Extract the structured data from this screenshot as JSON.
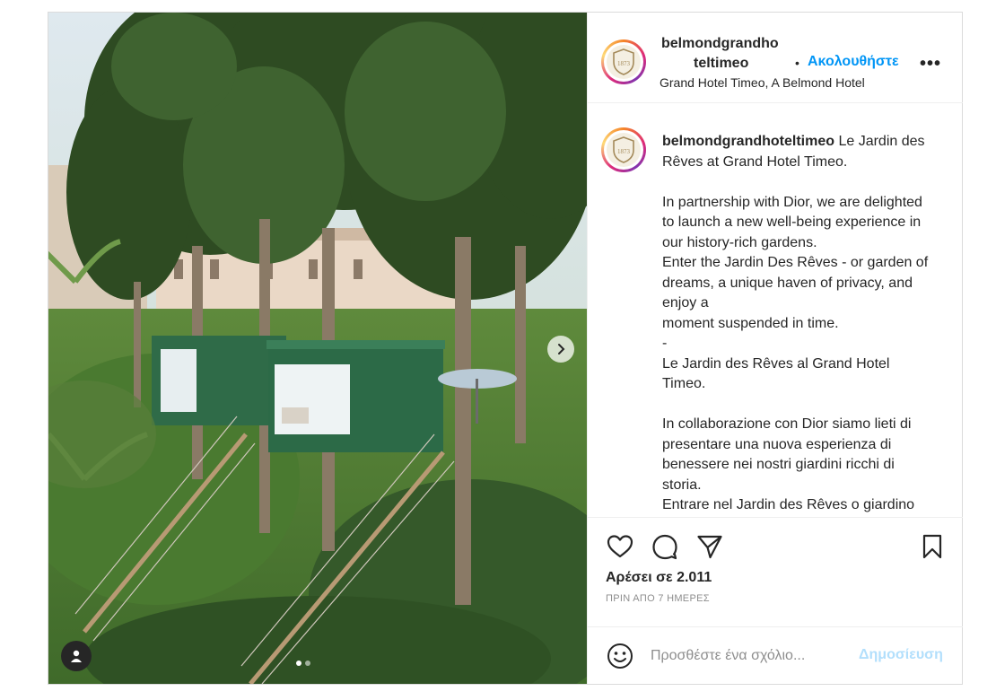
{
  "post": {
    "account": {
      "username_line1": "belmondgrandho",
      "username_line2": "teltimeo",
      "follow_label": "Ακολουθήστε",
      "bullet": "•",
      "more_label": "•••",
      "location": "Grand Hotel Timeo, A Belmond Hotel",
      "avatar_logo_text": "1873"
    },
    "media": {
      "carousel_dots": 2,
      "active_dot": 1
    },
    "caption": {
      "username": "belmondgrandhoteltimeo",
      "text": " Le Jardin des Rêves at Grand Hotel Timeo.\n\nIn partnership with Dior, we are delighted to launch a new well-being experience in our history-rich gardens.\nEnter the Jardin Des Rêves - or garden of dreams, a unique haven of privacy, and enjoy a\nmoment suspended in time.\n-\nLe Jardin des Rêves al Grand Hotel Timeo.\n\nIn collaborazione con Dior siamo lieti di presentare una nuova esperienza di benessere nei nostri giardini ricchi di storia.\nEntrare nel Jardin des Rêves o giardino"
    },
    "engagement": {
      "likes_label": "Αρέσει σε 2.011",
      "time_ago": "ΠΡΙΝ ΑΠΟ 7 ΗΜΕΡΕΣ"
    },
    "comment_box": {
      "placeholder": "Προσθέστε ένα σχόλιο...",
      "post_label": "Δημοσίευση"
    }
  },
  "colors": {
    "accent": "#0095f6",
    "post_disabled": "#b2dffc",
    "muted": "#8e8e8e",
    "text": "#262626",
    "border": "#dbdbdb"
  },
  "icons": {
    "next": "chevron-right-icon",
    "tag": "user-icon",
    "like": "heart-icon",
    "comment": "comment-icon",
    "share": "paper-plane-icon",
    "save": "bookmark-icon",
    "emoji": "smiley-icon"
  }
}
